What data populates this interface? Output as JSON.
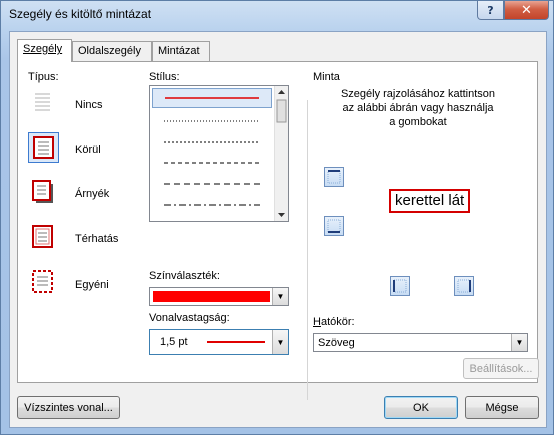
{
  "window": {
    "title": "Szegély és kitöltő mintázat",
    "help_glyph": "?",
    "close_glyph": "✕"
  },
  "tabs": [
    {
      "label": "Szegély",
      "active": true
    },
    {
      "label": "Oldalszegély",
      "active": false
    },
    {
      "label": "Mintázat",
      "active": false
    }
  ],
  "type": {
    "label": "Típus:",
    "items": [
      {
        "label": "Nincs",
        "icon": "none-border-icon",
        "selected": false
      },
      {
        "label": "Körül",
        "icon": "box-border-icon",
        "selected": true
      },
      {
        "label": "Árnyék",
        "icon": "shadow-border-icon",
        "selected": false
      },
      {
        "label": "Térhatás",
        "icon": "3d-border-icon",
        "selected": false
      },
      {
        "label": "Egyéni",
        "icon": "custom-border-icon",
        "selected": false
      }
    ]
  },
  "style": {
    "label": "Stílus:",
    "items": [
      "solid",
      "dotted",
      "dashed-short",
      "dashed",
      "dashed-long",
      "dash-dot"
    ],
    "selected_index": 0,
    "selected_color": "#e00000"
  },
  "color": {
    "label": "Színválaszték:",
    "value": "#ff0000"
  },
  "width": {
    "label": "Vonalvastagság:",
    "value": "1,5 pt"
  },
  "preview": {
    "title": "Minta",
    "hint": [
      "Szegély rajzolásához kattintson",
      "az alábbi ábrán vagy használja",
      "a gombokat"
    ],
    "sample_text": "kerettel lát",
    "border_color": "#d40000"
  },
  "applies_to": {
    "label": "Hatókör:",
    "value": "Szöveg"
  },
  "buttons": {
    "options": "Beállítások...",
    "horizontal_line": "Vízszintes vonal...",
    "ok": "OK",
    "cancel": "Mégse"
  }
}
